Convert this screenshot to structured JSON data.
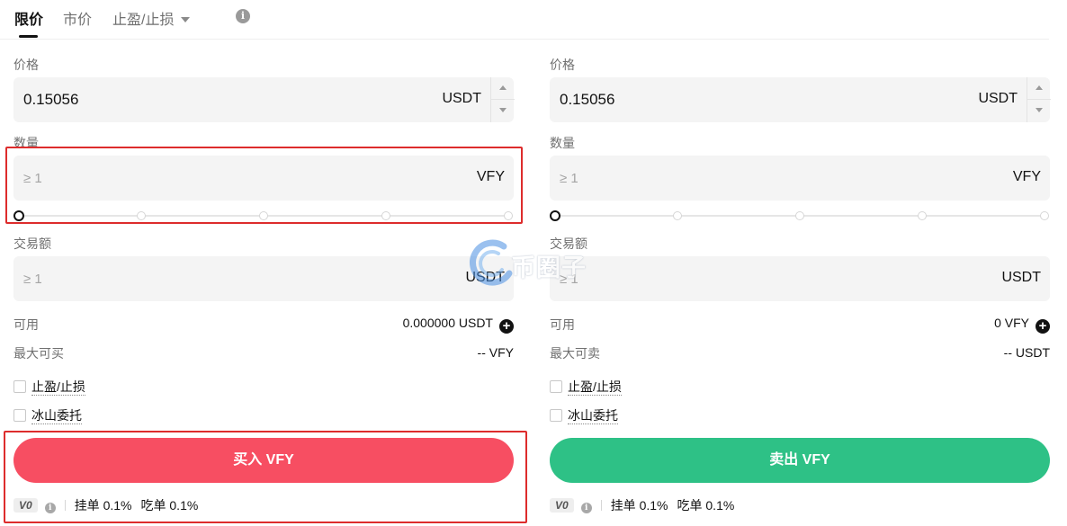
{
  "tabs": {
    "limit": "限价",
    "market": "市价",
    "tpsl": "止盈/止损"
  },
  "buy": {
    "price_label": "价格",
    "price_value": "0.15056",
    "price_unit": "USDT",
    "amount_label": "数量",
    "amount_placeholder": "≥ 1",
    "amount_unit": "VFY",
    "total_label": "交易额",
    "total_placeholder": "≥ 1",
    "total_unit": "USDT",
    "available_label": "可用",
    "available_value": "0.000000 USDT",
    "max_label": "最大可买",
    "max_value": "-- VFY",
    "tpsl_label": "止盈/止损",
    "iceberg_label": "冰山委托",
    "button_label": "买入 VFY",
    "slider_percent": 0,
    "vip_level": "V0",
    "maker_fee": "挂单 0.1%",
    "taker_fee": "吃单 0.1%"
  },
  "sell": {
    "price_label": "价格",
    "price_value": "0.15056",
    "price_unit": "USDT",
    "amount_label": "数量",
    "amount_placeholder": "≥ 1",
    "amount_unit": "VFY",
    "total_label": "交易额",
    "total_placeholder": "≥ 1",
    "total_unit": "USDT",
    "available_label": "可用",
    "available_value": "0 VFY",
    "max_label": "最大可卖",
    "max_value": "-- USDT",
    "tpsl_label": "止盈/止损",
    "iceberg_label": "冰山委托",
    "button_label": "卖出 VFY",
    "slider_percent": 0,
    "vip_level": "V0",
    "maker_fee": "挂单 0.1%",
    "taker_fee": "吃单 0.1%"
  },
  "watermark": "币圈子",
  "colors": {
    "buy": "#f74e62",
    "sell": "#2ec186",
    "annotation": "#dd2c2c"
  }
}
